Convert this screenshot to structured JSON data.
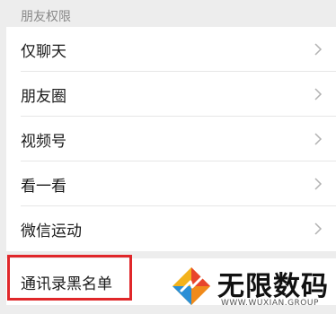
{
  "section": {
    "title": "朋友权限"
  },
  "items": [
    {
      "label": "仅聊天"
    },
    {
      "label": "朋友圈"
    },
    {
      "label": "视频号"
    },
    {
      "label": "看一看"
    },
    {
      "label": "微信运动"
    }
  ],
  "blacklist": {
    "label": "通讯录黑名单"
  },
  "watermark": {
    "title": "无限数码",
    "subtitle": "WWW.WUXIAN.GROUP"
  },
  "colors": {
    "highlight": "#e0272a",
    "background": "#ededed"
  }
}
